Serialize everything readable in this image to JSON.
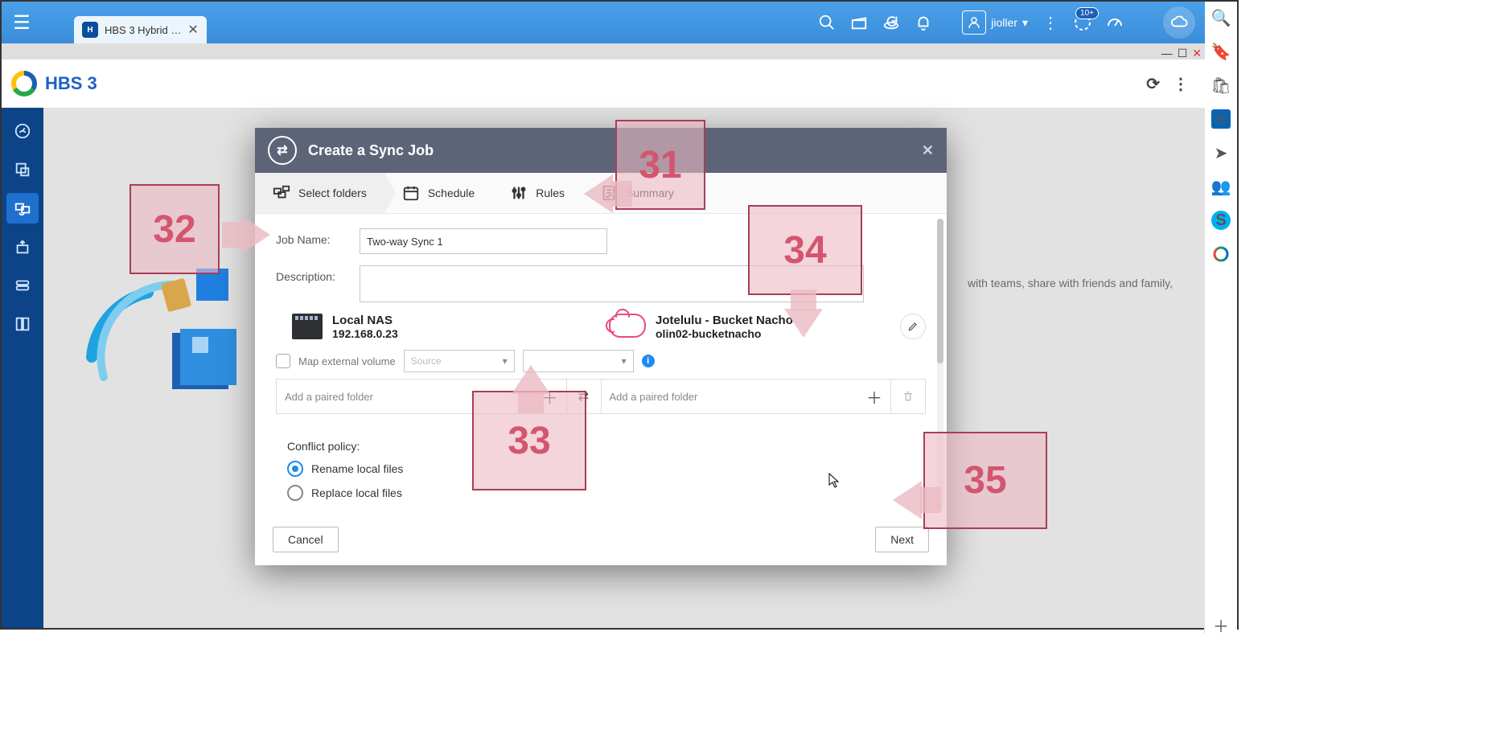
{
  "topbar": {
    "tab_title": "HBS 3 Hybrid …",
    "user": "jioller",
    "user_caret": "▾",
    "badge10": "10+"
  },
  "right_rail_icons": [
    "search",
    "tag",
    "shop",
    "outlook",
    "telegram",
    "silhouette",
    "skype",
    "office",
    "spacer",
    "plus"
  ],
  "hbs": {
    "title": "HBS 3"
  },
  "bg_text": "with teams, share with friends and family,",
  "modal": {
    "title": "Create a Sync Job",
    "steps": {
      "select_folders": "Select folders",
      "schedule": "Schedule",
      "rules": "Rules",
      "summary": "Summary"
    },
    "labels": {
      "job_name": "Job Name:",
      "description": "Description:"
    },
    "job_name_value": "Two-way Sync 1",
    "local": {
      "title": "Local NAS",
      "sub": "192.168.0.23"
    },
    "remote": {
      "title": "Jotelulu - Bucket Nacho",
      "sub": "olin02-bucketnacho"
    },
    "map_external": "Map external volume",
    "source_placeholder": "Source",
    "pair_placeholder_left": "Add a paired folder",
    "pair_placeholder_right": "Add a paired folder",
    "conflict": {
      "head": "Conflict policy:",
      "rename": "Rename local files",
      "replace": "Replace local files"
    },
    "buttons": {
      "cancel": "Cancel",
      "next": "Next"
    }
  },
  "overlays": {
    "n31": "31",
    "n32": "32",
    "n33": "33",
    "n34": "34",
    "n35": "35"
  }
}
